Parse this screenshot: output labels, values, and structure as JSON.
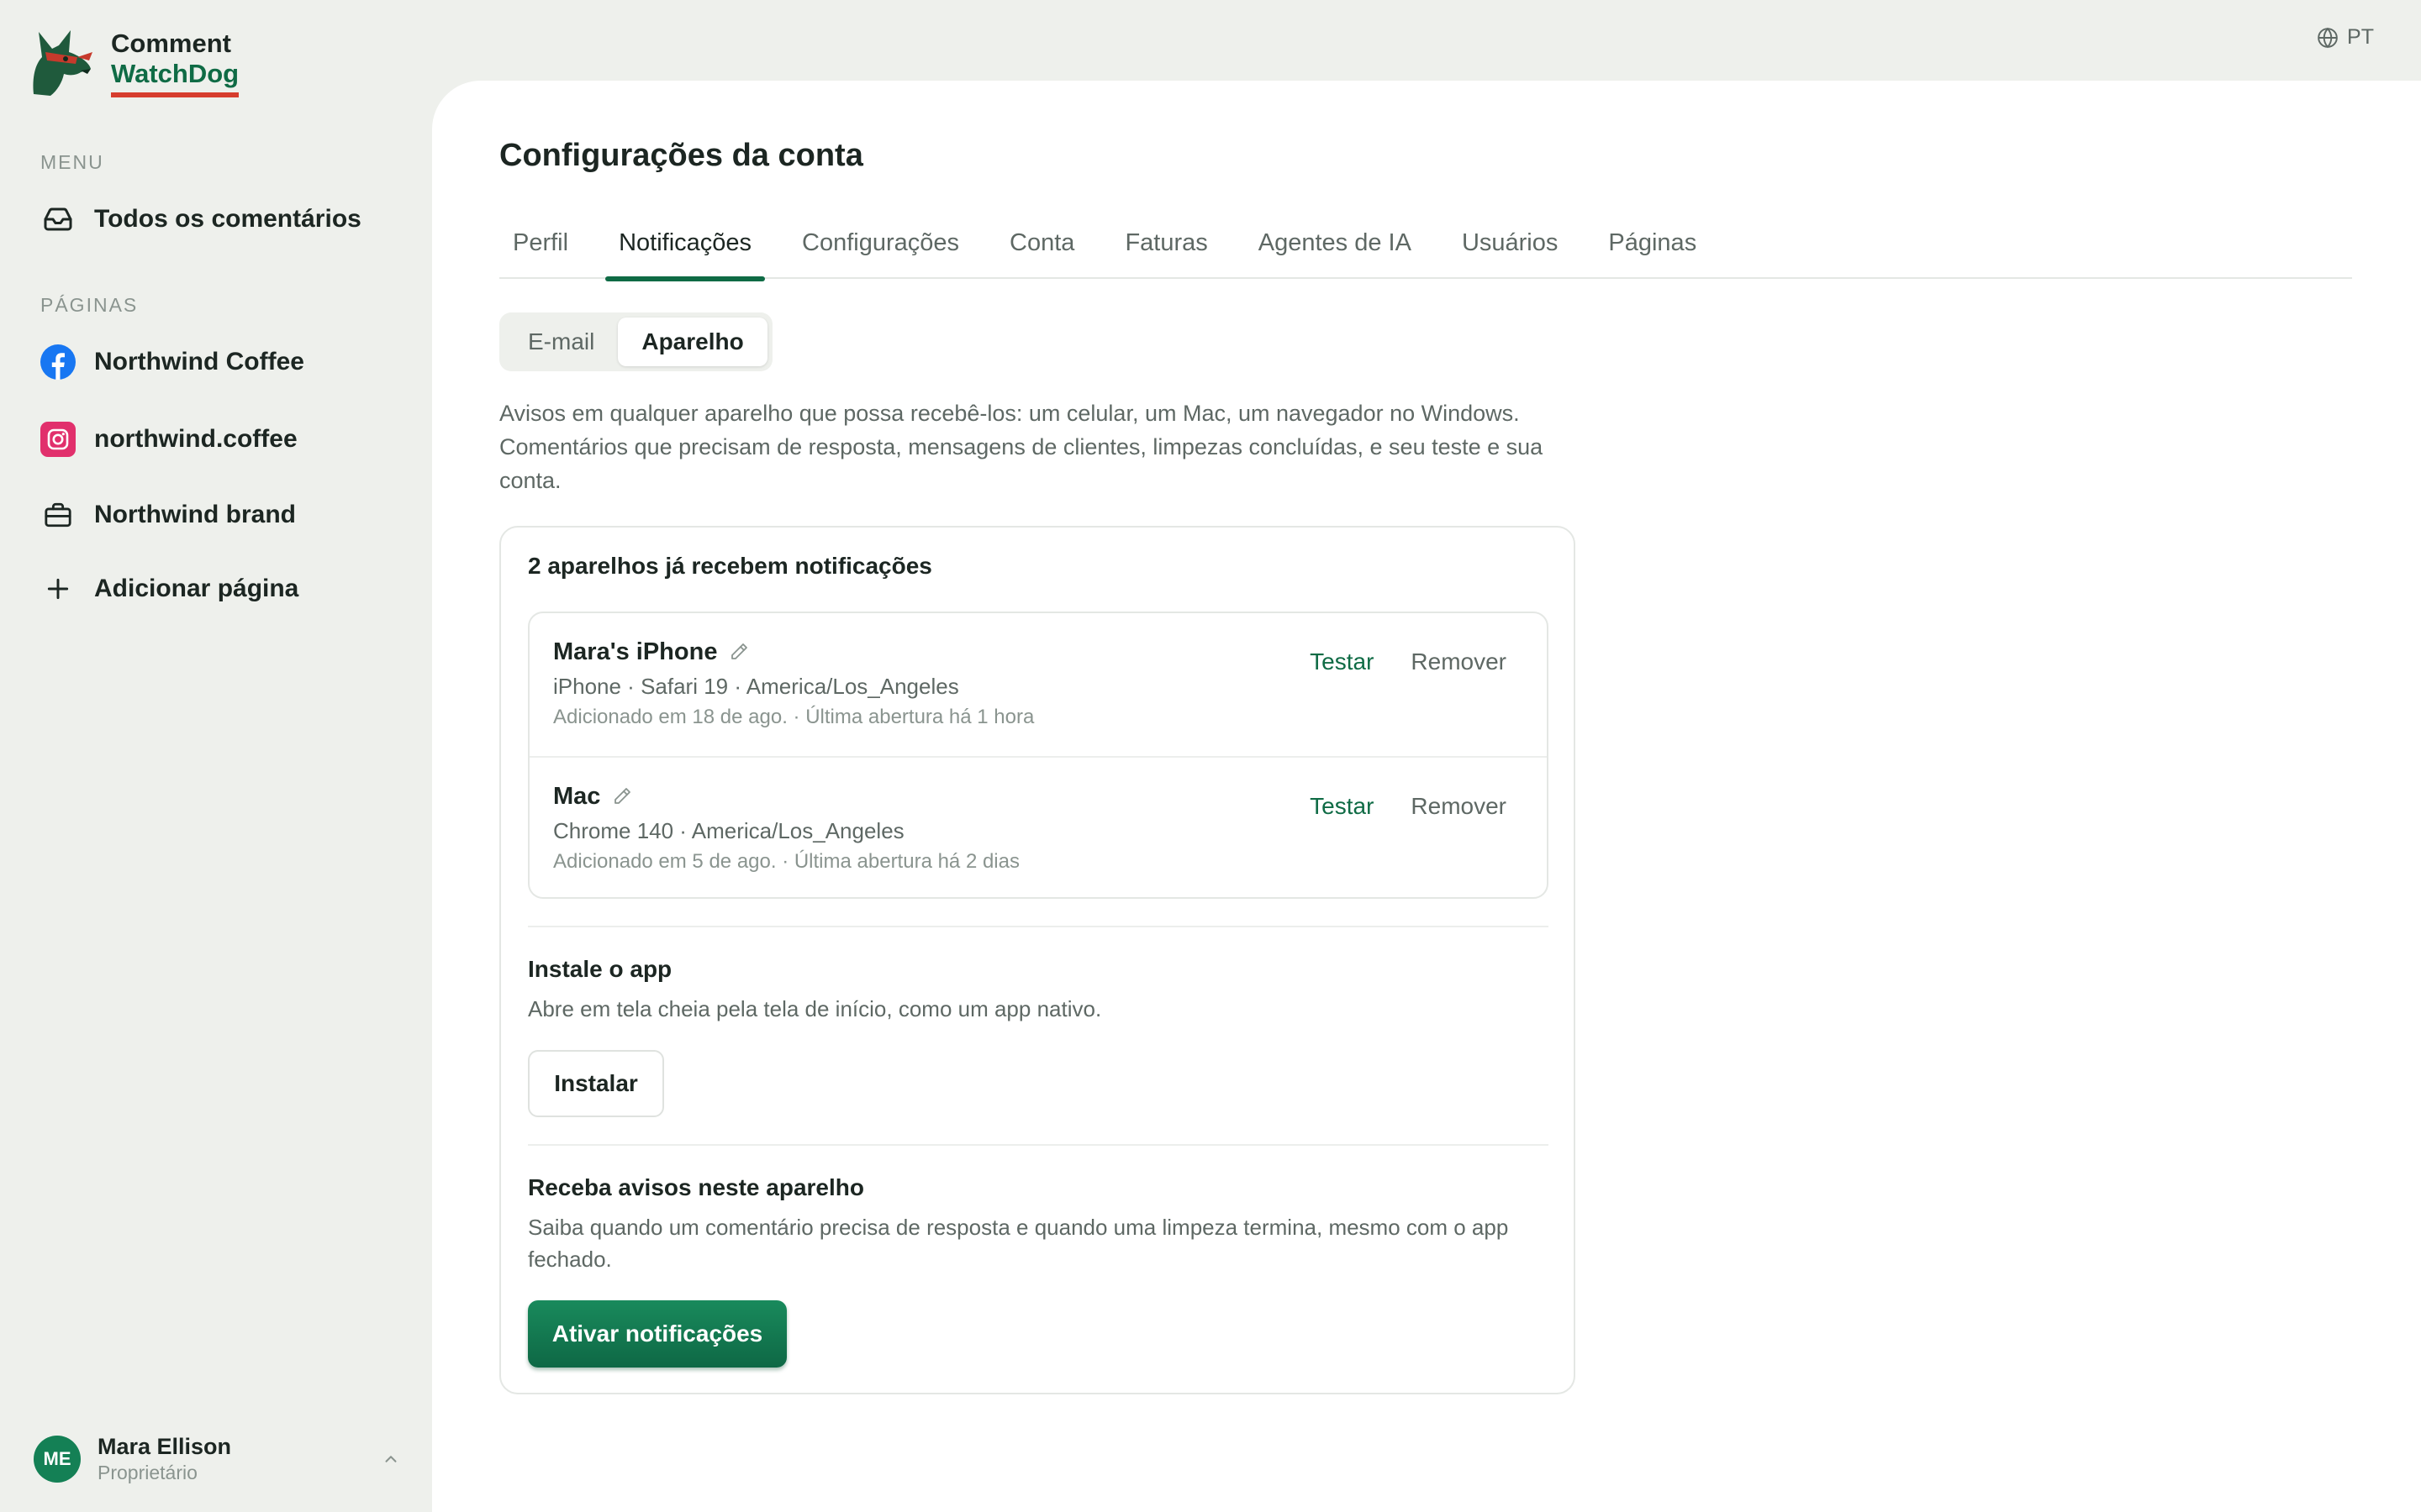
{
  "brand": {
    "line1": "Comment",
    "line2": "WatchDog"
  },
  "sidebar": {
    "menu_label": "MENU",
    "menu_items": [
      {
        "label": "Todos os comentários",
        "icon": "inbox-icon"
      }
    ],
    "pages_label": "PÁGINAS",
    "pages": [
      {
        "label": "Northwind Coffee",
        "icon": "facebook-icon"
      },
      {
        "label": "northwind.coffee",
        "icon": "instagram-icon"
      },
      {
        "label": "Northwind brand",
        "icon": "briefcase-icon"
      },
      {
        "label": "Adicionar página",
        "icon": "plus-icon"
      }
    ]
  },
  "user": {
    "initials": "ME",
    "name": "Mara Ellison",
    "role": "Proprietário"
  },
  "language": {
    "code": "PT",
    "icon": "globe-icon"
  },
  "page": {
    "title": "Configurações da conta"
  },
  "tabs": [
    {
      "label": "Perfil"
    },
    {
      "label": "Notificações",
      "active": true
    },
    {
      "label": "Configurações"
    },
    {
      "label": "Conta"
    },
    {
      "label": "Faturas"
    },
    {
      "label": "Agentes de IA"
    },
    {
      "label": "Usuários"
    },
    {
      "label": "Páginas"
    }
  ],
  "channels": {
    "email": "E-mail",
    "device": "Aparelho",
    "selected": "Aparelho"
  },
  "description": "Avisos em qualquer aparelho que possa recebê-los: um celular, um Mac, um navegador no Windows. Comentários que precisam de resposta, mensagens de clientes, limpezas concluídas, e seu teste e sua conta.",
  "devices": {
    "title": "2 aparelhos já recebem notificações",
    "items": [
      {
        "name": "Mara's iPhone",
        "meta": "iPhone · Safari 19 · America/Los_Angeles",
        "sub": "Adicionado em 18 de ago. · Última abertura há 1 hora",
        "test_label": "Testar",
        "remove_label": "Remover"
      },
      {
        "name": "Mac",
        "meta": "Chrome 140 · America/Los_Angeles",
        "sub": "Adicionado em 5 de ago. · Última abertura há 2 dias",
        "test_label": "Testar",
        "remove_label": "Remover"
      }
    ]
  },
  "install": {
    "title": "Instale o app",
    "text": "Abre em tela cheia pela tela de início, como um app nativo.",
    "button": "Instalar"
  },
  "enable": {
    "title": "Receba avisos neste aparelho",
    "text": "Saiba quando um comentário precisa de resposta e quando uma limpeza termina, mesmo com o app fechado.",
    "button": "Ativar notificações"
  },
  "colors": {
    "accent": "#0f6b45",
    "background": "#eef0ec",
    "logo_underline": "#d63d2e",
    "facebook": "#1877f2",
    "instagram": "#e1306c"
  }
}
